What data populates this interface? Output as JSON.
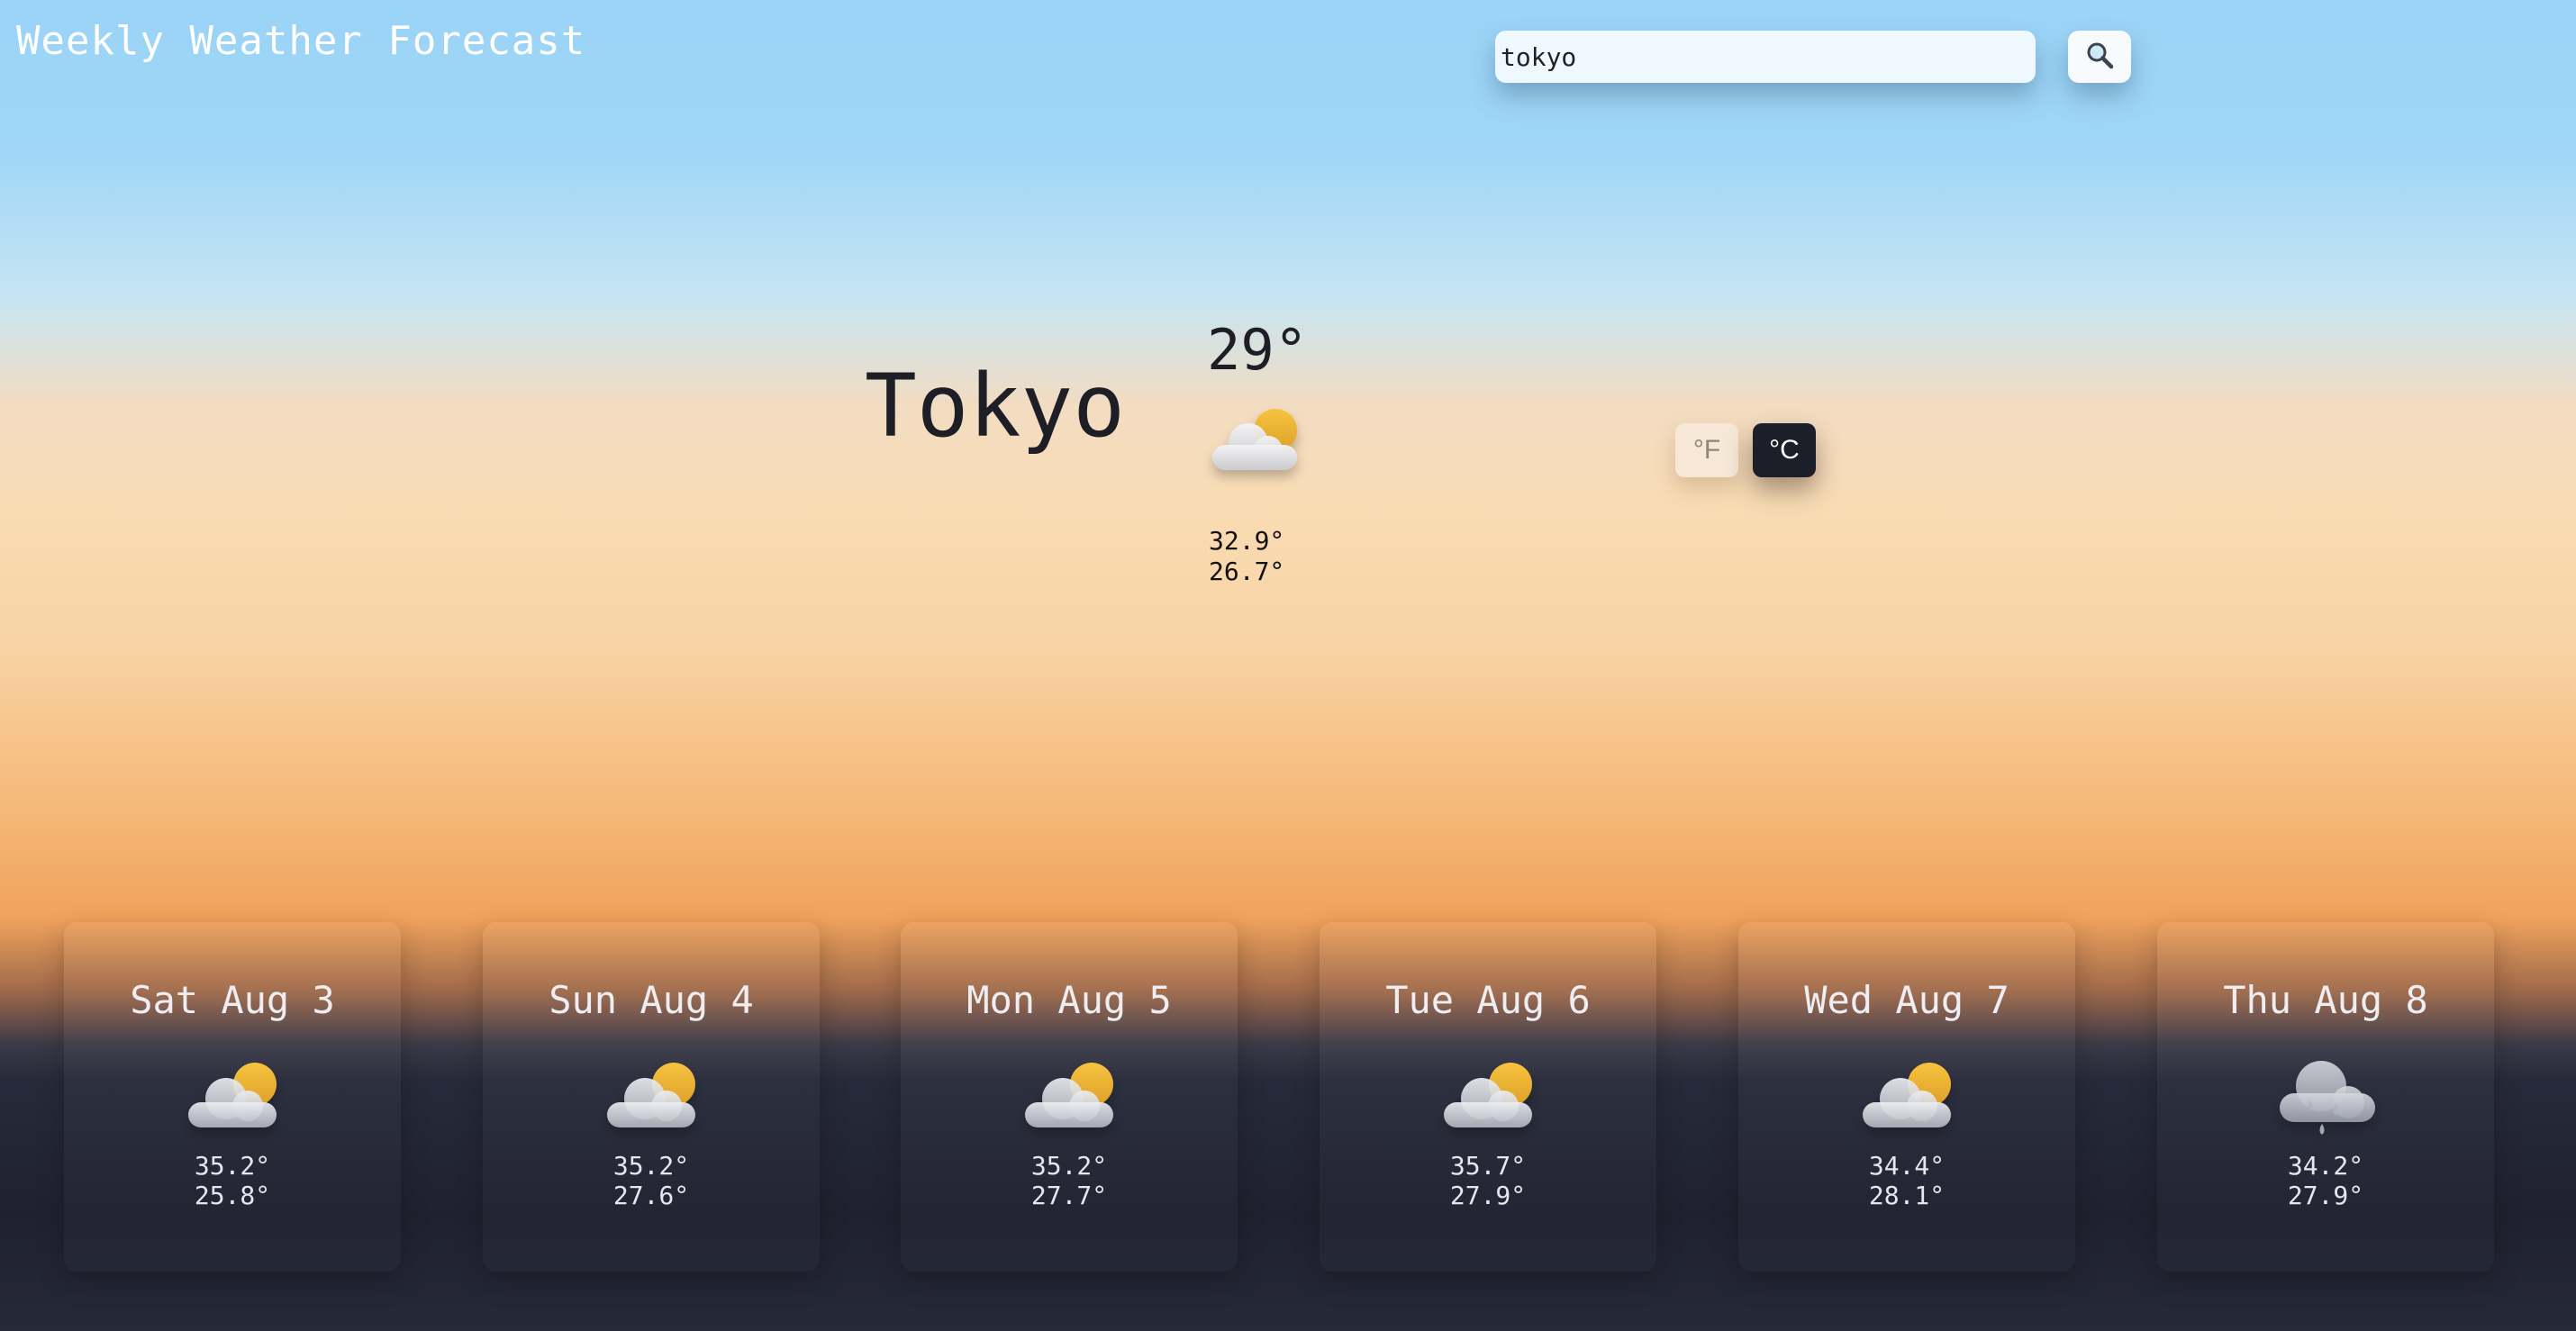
{
  "header": {
    "title": "Weekly Weather Forecast"
  },
  "search": {
    "value": "tokyo",
    "button_icon": "search-icon"
  },
  "current": {
    "city": "Tokyo",
    "temp": "29°",
    "icon": "partly-cloudy-icon",
    "high": "32.9°",
    "low": "26.7°"
  },
  "units": {
    "fahrenheit_label": "°F",
    "celsius_label": "°C",
    "selected": "°C"
  },
  "forecast": [
    {
      "day": "Sat Aug 3",
      "icon": "partly-cloudy-icon",
      "high": "35.2°",
      "low": "25.8°"
    },
    {
      "day": "Sun Aug 4",
      "icon": "partly-cloudy-icon",
      "high": "35.2°",
      "low": "27.6°"
    },
    {
      "day": "Mon Aug 5",
      "icon": "partly-cloudy-icon",
      "high": "35.2°",
      "low": "27.7°"
    },
    {
      "day": "Tue Aug 6",
      "icon": "partly-cloudy-icon",
      "high": "35.7°",
      "low": "27.9°"
    },
    {
      "day": "Wed Aug 7",
      "icon": "partly-cloudy-icon",
      "high": "34.4°",
      "low": "28.1°"
    },
    {
      "day": "Thu Aug 8",
      "icon": "rain-cloud-icon",
      "high": "34.2°",
      "low": "27.9°"
    }
  ]
}
